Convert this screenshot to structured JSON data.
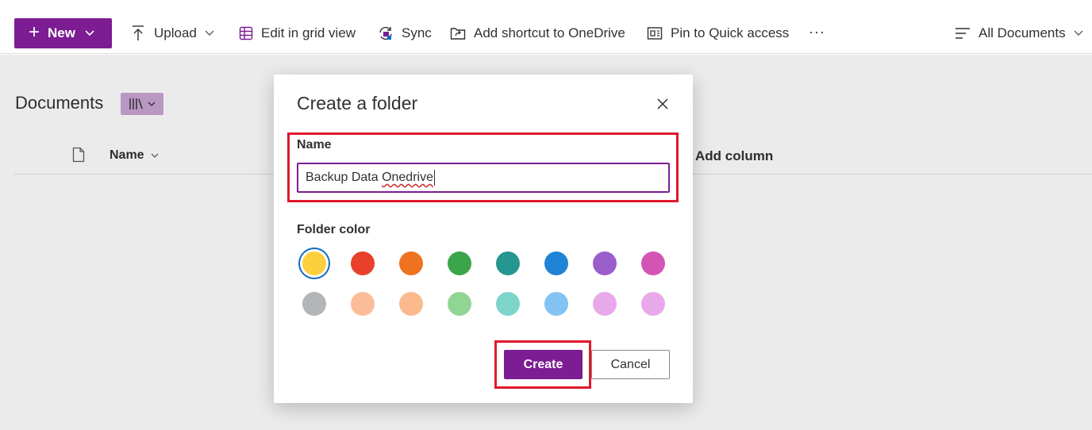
{
  "toolbar": {
    "new_label": "New",
    "upload_label": "Upload",
    "grid_label": "Edit in grid view",
    "sync_label": "Sync",
    "shortcut_label": "Add shortcut to OneDrive",
    "pin_label": "Pin to Quick access",
    "more_label": "···",
    "view_label": "All Documents"
  },
  "library": {
    "title": "Documents",
    "name_column": "Name",
    "add_column": "Add column"
  },
  "dialog": {
    "title": "Create a folder",
    "name_label": "Name",
    "name_value_plain": "Backup Data ",
    "name_value_misspelled": "Onedrive",
    "color_label": "Folder color",
    "create_label": "Create",
    "cancel_label": "Cancel"
  },
  "folder_colors": {
    "row1": [
      "#fcd03c",
      "#e8402b",
      "#ef7220",
      "#3aa54b",
      "#269690",
      "#1f83d6",
      "#9a5fcb",
      "#d454b3"
    ],
    "row2": [
      "#b3b6b7",
      "#fbbc9a",
      "#fbb98e",
      "#91d595",
      "#7dd4cb",
      "#83c3f3",
      "#e8a9eb",
      "#e8a9eb"
    ],
    "selected": "#fcd03c"
  },
  "colors": {
    "accent": "#7c1d93",
    "highlight": "#e0182d"
  }
}
